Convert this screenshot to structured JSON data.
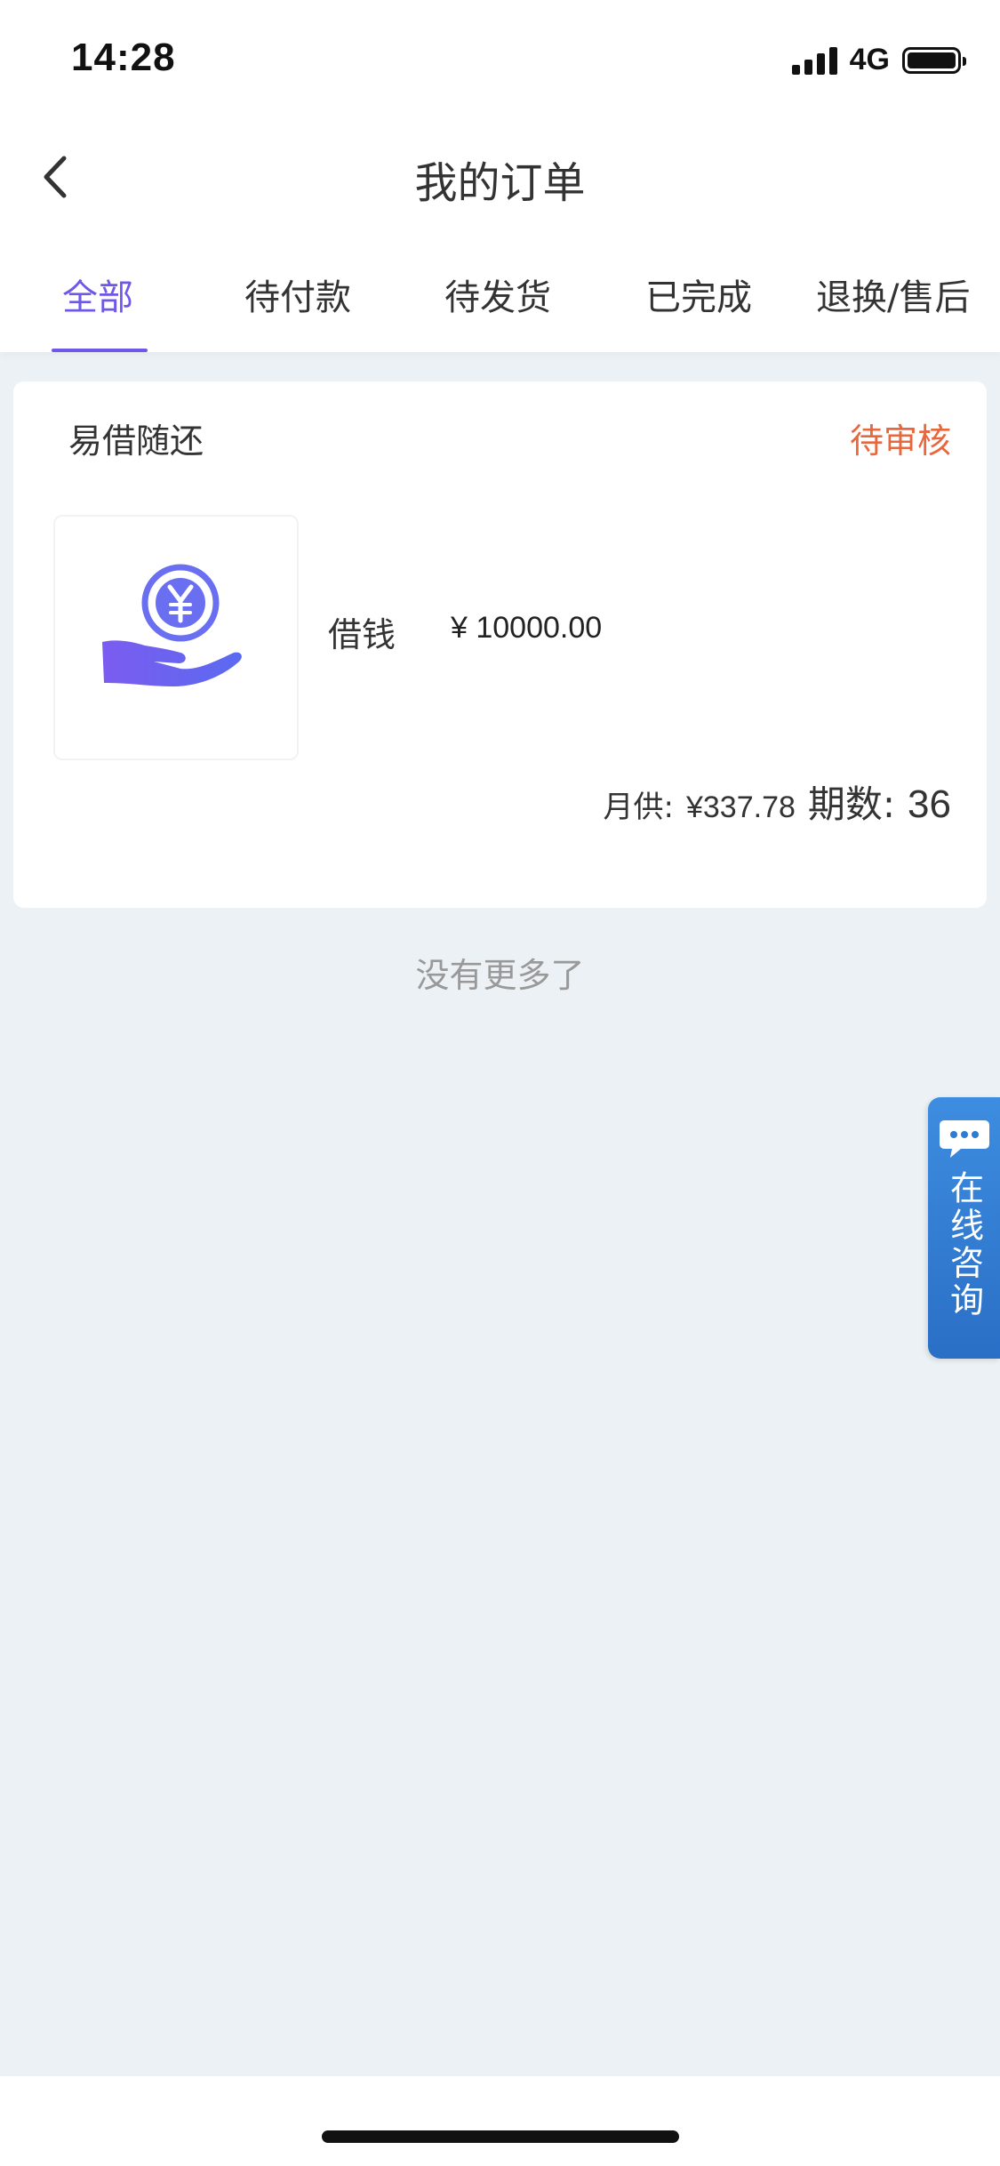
{
  "status_bar": {
    "time": "14:28",
    "network": "4G"
  },
  "nav": {
    "title": "我的订单",
    "back_icon": "chevron-left-icon"
  },
  "tabs": [
    {
      "label": "全部",
      "active": true
    },
    {
      "label": "待付款",
      "active": false
    },
    {
      "label": "待发货",
      "active": false
    },
    {
      "label": "已完成",
      "active": false
    },
    {
      "label": "退换/售后",
      "active": false
    }
  ],
  "order": {
    "shop_name": "易借随还",
    "status": "待审核",
    "product_icon": "hand-yuan-coin-icon",
    "product_name": "借钱",
    "price": "¥ 10000.00",
    "monthly_label": "月供:",
    "monthly_value": "¥337.78",
    "periods_label": "期数:",
    "periods_value": "36"
  },
  "footer": {
    "no_more": "没有更多了"
  },
  "consult": {
    "label": "在线咨询",
    "icon": "chat-bubble-icon"
  },
  "colors": {
    "accent": "#6e58e8",
    "status": "#e8683e",
    "background": "#ebf1f4",
    "consult": "#2f7bd2"
  }
}
